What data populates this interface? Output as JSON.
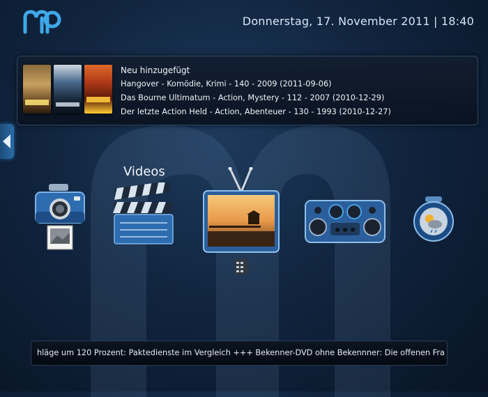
{
  "header": {
    "datetime": "Donnerstag, 17. November 2011 | 18:40"
  },
  "recent": {
    "heading": "Neu hinzugefügt",
    "items": [
      "Hangover - Komödie, Krimi - 140 - 2009  (2011-09-06)",
      "Das Bourne Ultimatum - Action, Mystery - 112 - 2007  (2010-12-29)",
      "Der letzte Action Held - Action, Abenteuer - 130 - 1993  (2010-12-27)"
    ]
  },
  "menu": {
    "selected_label": "Videos",
    "items": [
      {
        "icon": "camera-pictures-icon"
      },
      {
        "icon": "clapperboard-videos-icon"
      },
      {
        "icon": "tv-icon"
      },
      {
        "icon": "radio-music-icon"
      },
      {
        "icon": "weather-icon"
      }
    ]
  },
  "ticker": {
    "text": "hläge um 120 Prozent: Paktedienste im Vergleich +++ Bekenner-DVD ohne Bekennner: Die offenen Fra"
  },
  "colors": {
    "background": "#112540",
    "accent": "#2a6ca8",
    "text": "#f0f4f8"
  }
}
